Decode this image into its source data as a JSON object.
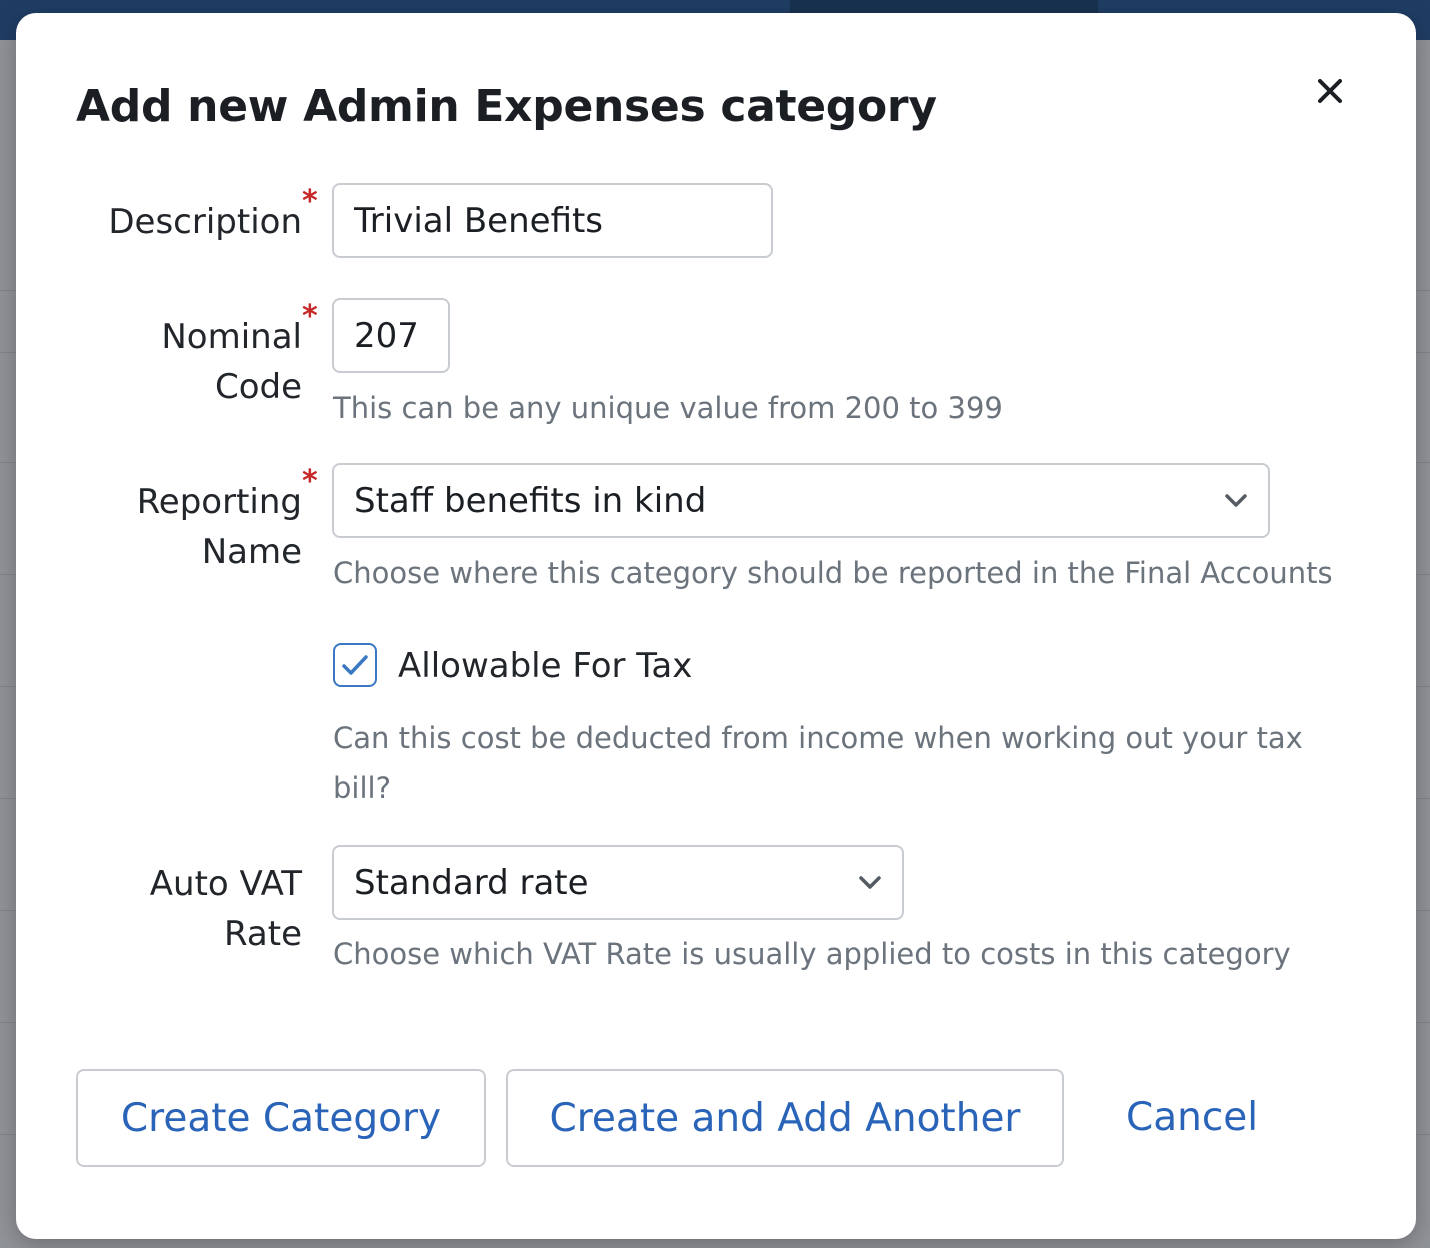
{
  "modal": {
    "title": "Add new Admin Expenses category",
    "close_icon": "close-icon"
  },
  "form": {
    "description": {
      "label": "Description",
      "required_mark": "*",
      "value": "Trivial Benefits"
    },
    "nominal_code": {
      "label_line1": "Nominal",
      "label_line2": "Code",
      "required_mark": "*",
      "value": "207",
      "hint": "This can be any unique value from 200 to 399"
    },
    "reporting_name": {
      "label_line1": "Reporting",
      "label_line2": "Name",
      "required_mark": "*",
      "selected": "Staff benefits in kind",
      "hint": "Choose where this category should be reported in the Final Accounts"
    },
    "allowable_for_tax": {
      "label": "Allowable For Tax",
      "checked": true,
      "hint_line1": "Can this cost be deducted from income when working out your tax",
      "hint_line2": "bill?"
    },
    "auto_vat_rate": {
      "label_line1": "Auto VAT",
      "label_line2": "Rate",
      "selected": "Standard rate",
      "hint": "Choose which VAT Rate is usually applied to costs in this category"
    }
  },
  "actions": {
    "create_label": "Create Category",
    "create_another_label": "Create and Add Another",
    "cancel_label": "Cancel"
  },
  "colors": {
    "accent": "#2a64b8",
    "required": "#c62828",
    "hint_text": "#6b737c",
    "border": "#c8ccd1"
  }
}
